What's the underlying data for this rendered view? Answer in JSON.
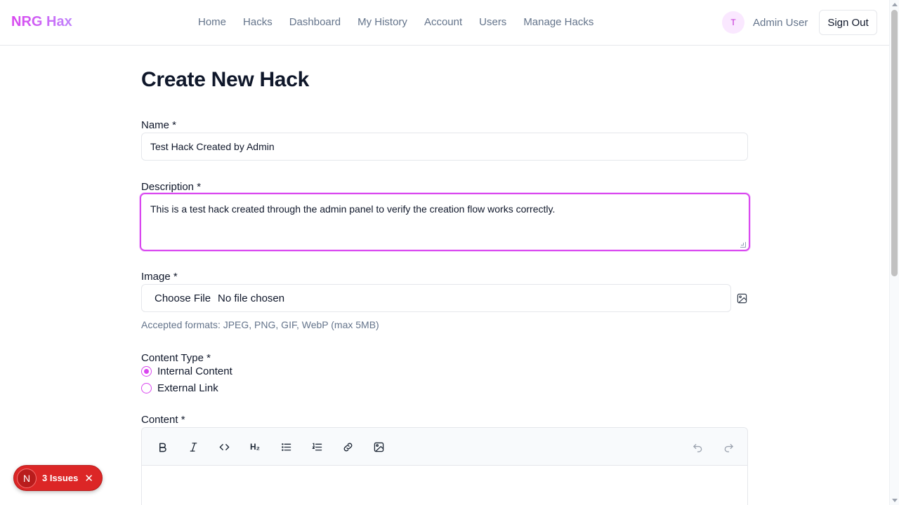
{
  "header": {
    "brand": "NRG Hax",
    "nav": [
      "Home",
      "Hacks",
      "Dashboard",
      "My History",
      "Account",
      "Users",
      "Manage Hacks"
    ],
    "avatar_initial": "T",
    "user_name": "Admin User",
    "sign_out": "Sign Out"
  },
  "page": {
    "title": "Create New Hack"
  },
  "form": {
    "name_label": "Name *",
    "name_value": "Test Hack Created by Admin",
    "description_label": "Description *",
    "description_value": "This is a test hack created through the admin panel to verify the creation flow works correctly.",
    "image_label": "Image *",
    "choose_file": "Choose File",
    "no_file": "No file chosen",
    "image_hint": "Accepted formats: JPEG, PNG, GIF, WebP (max 5MB)",
    "content_type_label": "Content Type *",
    "content_type_options": [
      {
        "label": "Internal Content",
        "selected": true
      },
      {
        "label": "External Link",
        "selected": false
      }
    ],
    "content_label": "Content *"
  },
  "editor": {
    "tools": [
      "bold-icon",
      "italic-icon",
      "code-icon",
      "heading-icon",
      "bullet-list-icon",
      "ordered-list-icon",
      "link-icon",
      "image-icon",
      "undo-icon",
      "redo-icon"
    ],
    "heading_glyph": "H₂"
  },
  "issues_badge": {
    "logo": "N",
    "text": "3 Issues"
  },
  "colors": {
    "accent": "#d946ef",
    "issues_red": "#dc2626"
  }
}
